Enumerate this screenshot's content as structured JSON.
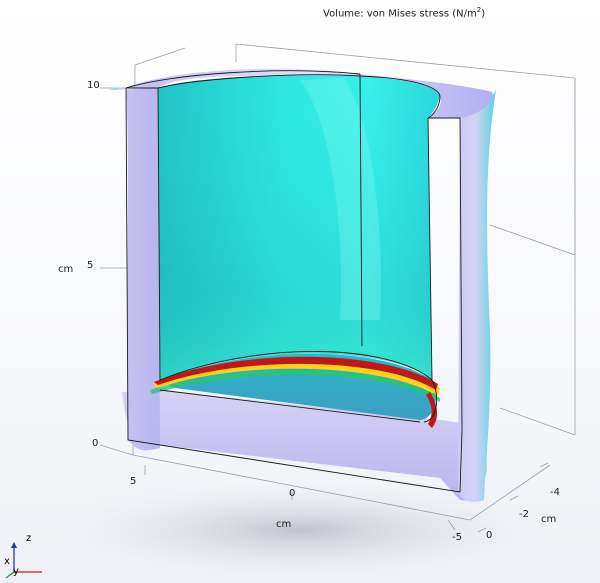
{
  "plot": {
    "title_prefix": "Volume: von Mises stress (N/m",
    "title_sup": "2",
    "title_suffix": ")"
  },
  "axes": {
    "z_ticks": [
      "10",
      "5",
      "0"
    ],
    "z_label": "cm",
    "x_ticks": [
      "5",
      "0",
      "-5"
    ],
    "x_label": "cm",
    "y_ticks": [
      "-4",
      "-2",
      "0"
    ],
    "y_label": "cm"
  },
  "triad": {
    "z": "z",
    "x": "x",
    "y": "y"
  },
  "colors": {
    "outer_surface": "#c9c3f2",
    "inner_cyan": "#2fe6df",
    "stress_peak": "#c01818",
    "stress_mid": "#ffd21a",
    "stress_low": "#27c47a"
  }
}
